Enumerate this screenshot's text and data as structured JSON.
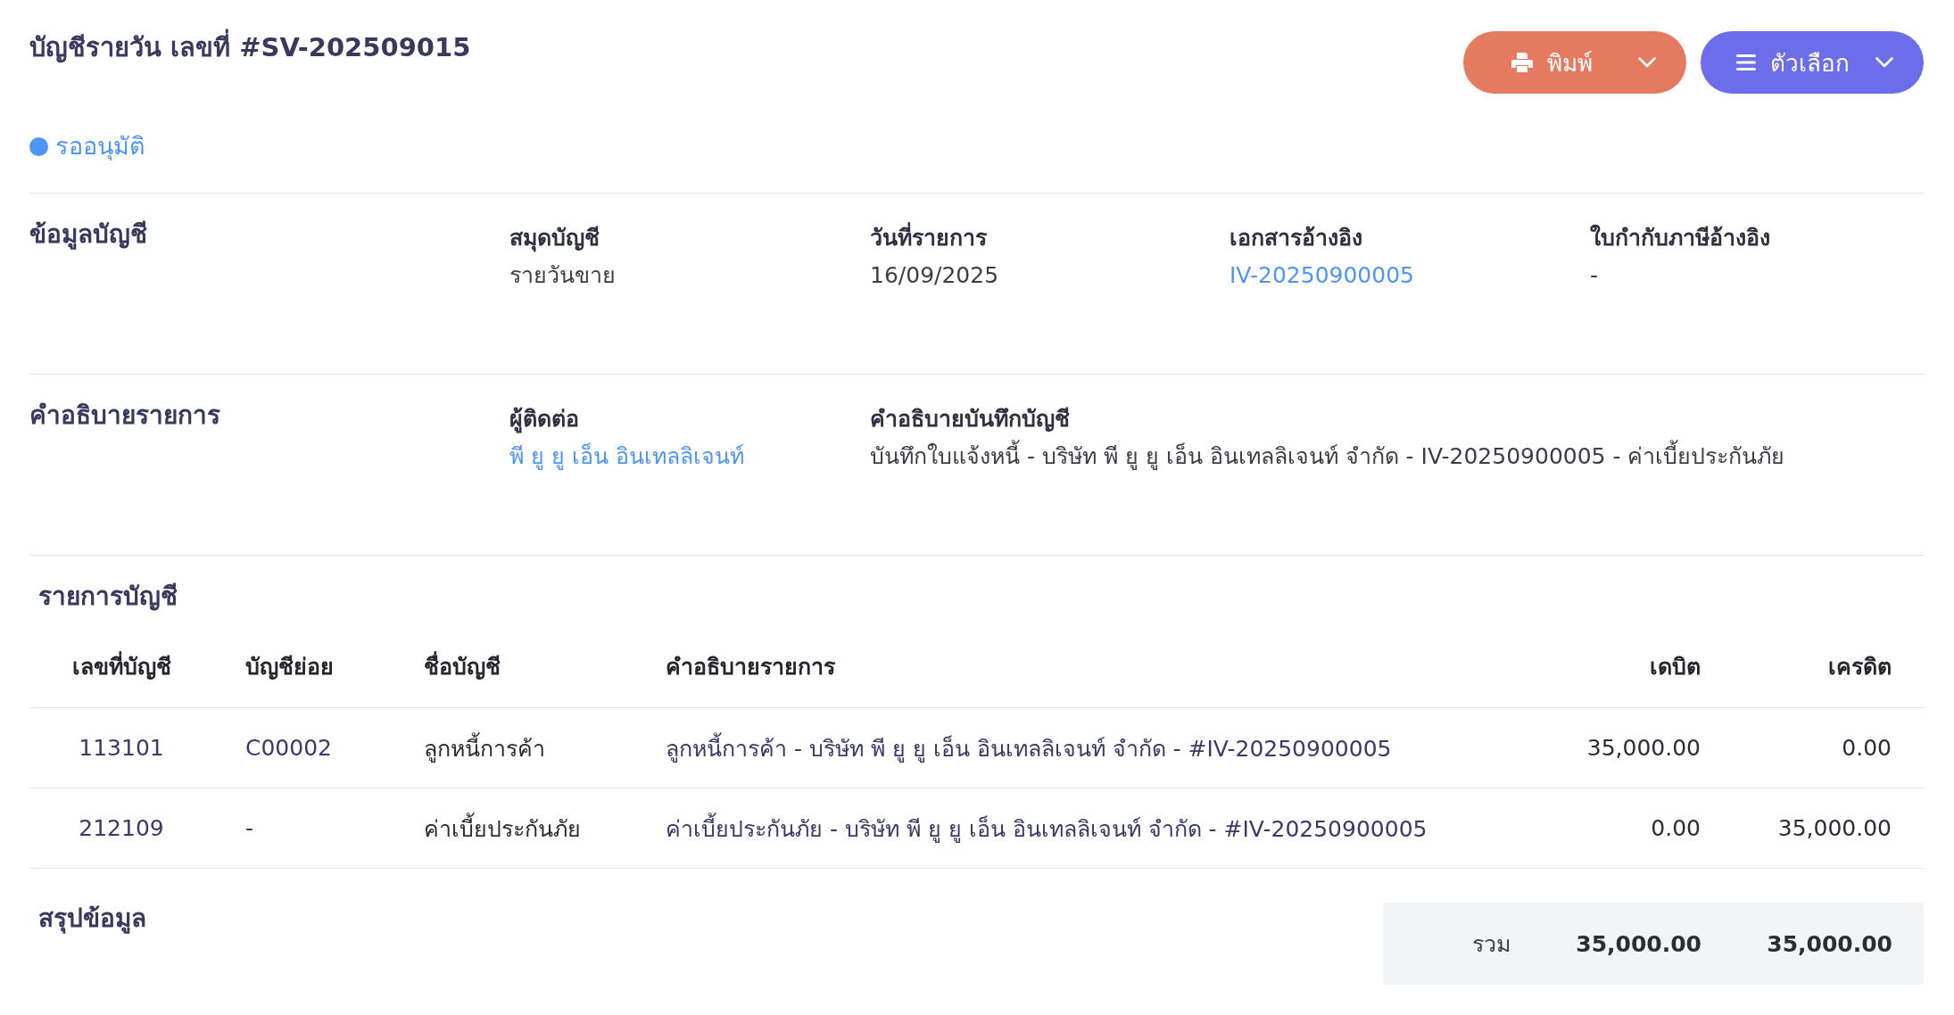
{
  "header": {
    "title": "บัญชีรายวัน เลขที่ #SV-202509015",
    "buttons": [
      {
        "kind": "print",
        "label": "พิมพ์"
      },
      {
        "kind": "options",
        "label": "ตัวเลือก"
      }
    ]
  },
  "status": {
    "label": "รออนุมัติ"
  },
  "account_info": {
    "heading": "ข้อมูลบัญชี",
    "fields": [
      {
        "label": "สมุดบัญชี",
        "value": "รายวันขาย",
        "kind": "text"
      },
      {
        "label": "วันที่รายการ",
        "value": "16/09/2025",
        "kind": "text"
      },
      {
        "label": "เอกสารอ้างอิง",
        "value": "IV-20250900005",
        "kind": "link"
      },
      {
        "label": "ใบกำกับภาษีอ้างอิง",
        "value": "-",
        "kind": "text"
      }
    ]
  },
  "transaction_description": {
    "heading": "คำอธิบายรายการ",
    "fields": [
      {
        "label": "ผู้ติดต่อ",
        "value": "พี ยู ยู เอ็น อินเทลลิเจนท์",
        "kind": "link"
      },
      {
        "label": "คำอธิบายบันทึกบัญชี",
        "value": "บันทึกใบแจ้งหนี้ - บริษัท พี ยู ยู เอ็น อินเทลลิเจนท์ จำกัด - IV-20250900005 - ค่าเบี้ยประกันภัย",
        "kind": "text"
      }
    ]
  },
  "entries": {
    "title": "รายการบัญชี",
    "columns": [
      "เลขที่บัญชี",
      "บัญชีย่อย",
      "ชื่อบัญชี",
      "คำอธิบายรายการ",
      "เดบิต",
      "เครดิต"
    ],
    "rows": [
      [
        "113101",
        "C00002",
        "ลูกหนี้การค้า",
        "ลูกหนี้การค้า - บริษัท พี ยู ยู เอ็น อินเทลลิเจนท์ จำกัด - #IV-20250900005",
        "35,000.00",
        "0.00"
      ],
      [
        "212109",
        "-",
        "ค่าเบี้ยประกันภัย",
        "ค่าเบี้ยประกันภัย - บริษัท พี ยู ยู เอ็น อินเทลลิเจนท์ จำกัด - #IV-20250900005",
        "0.00",
        "35,000.00"
      ]
    ]
  },
  "summary": {
    "heading": "สรุปข้อมูล",
    "total_label": "รวม",
    "total_debit": "35,000.00",
    "total_credit": "35,000.00"
  }
}
